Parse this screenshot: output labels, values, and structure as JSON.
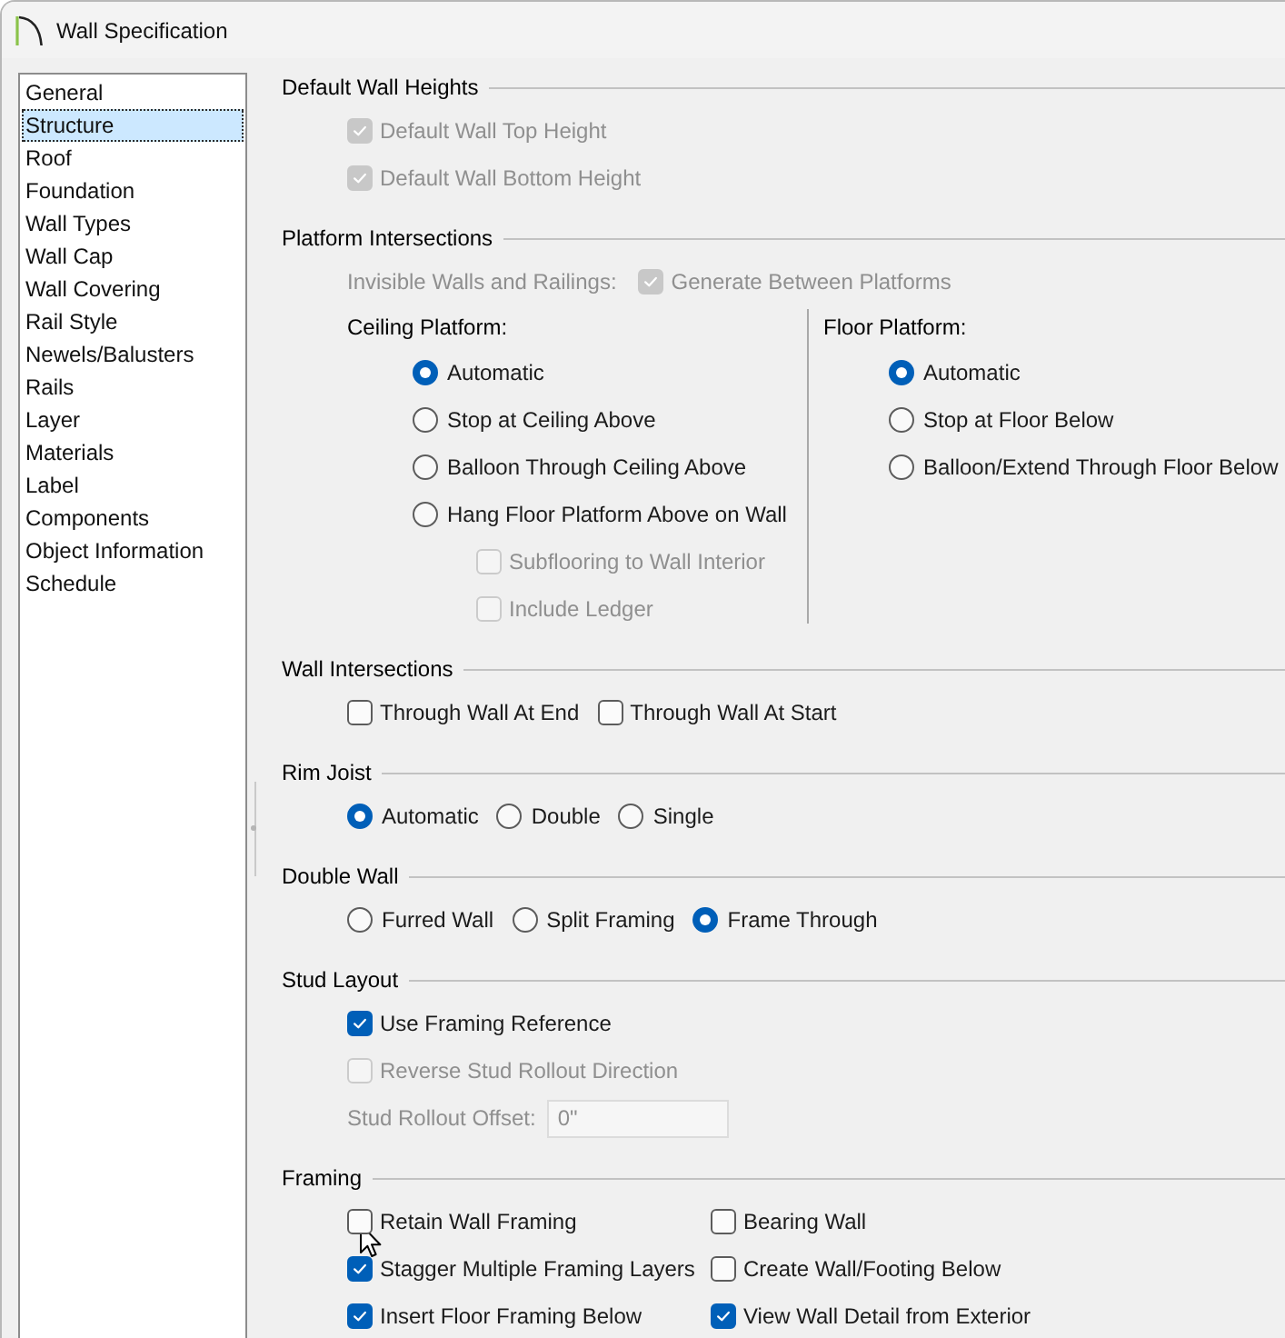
{
  "window": {
    "title": "Wall Specification"
  },
  "sidebar": {
    "items": [
      {
        "label": "General",
        "selected": false
      },
      {
        "label": "Structure",
        "selected": true
      },
      {
        "label": "Roof",
        "selected": false
      },
      {
        "label": "Foundation",
        "selected": false
      },
      {
        "label": "Wall Types",
        "selected": false
      },
      {
        "label": "Wall Cap",
        "selected": false
      },
      {
        "label": "Wall Covering",
        "selected": false
      },
      {
        "label": "Rail Style",
        "selected": false
      },
      {
        "label": "Newels/Balusters",
        "selected": false
      },
      {
        "label": "Rails",
        "selected": false
      },
      {
        "label": "Layer",
        "selected": false
      },
      {
        "label": "Materials",
        "selected": false
      },
      {
        "label": "Label",
        "selected": false
      },
      {
        "label": "Components",
        "selected": false
      },
      {
        "label": "Object Information",
        "selected": false
      },
      {
        "label": "Schedule",
        "selected": false
      }
    ]
  },
  "sections": [
    {
      "title": "Default Wall Heights",
      "rows": [
        {
          "kind": "checkbox",
          "label": "Default Wall Top Height",
          "checked": true,
          "disabled": true
        },
        {
          "kind": "checkbox",
          "label": "Default Wall Bottom Height",
          "checked": true,
          "disabled": true
        }
      ]
    },
    {
      "title": "Platform Intersections",
      "rows": [
        {
          "kind": "labeled",
          "label": "Invisible Walls and Railings:",
          "disabled": true,
          "controls": [
            {
              "kind": "checkbox",
              "label": "Generate Between Platforms",
              "checked": true,
              "disabled": true
            }
          ]
        },
        {
          "kind": "columns",
          "columns": [
            {
              "title": "Ceiling Platform:",
              "options": [
                {
                  "kind": "radio",
                  "label": "Automatic",
                  "selected": true,
                  "disabled": false
                },
                {
                  "kind": "radio",
                  "label": "Stop at Ceiling Above",
                  "selected": false,
                  "disabled": false
                },
                {
                  "kind": "radio",
                  "label": "Balloon Through Ceiling Above",
                  "selected": false,
                  "disabled": false
                },
                {
                  "kind": "radio",
                  "label": "Hang Floor Platform Above on Wall",
                  "selected": false,
                  "disabled": false,
                  "children": [
                    {
                      "kind": "checkbox",
                      "label": "Subflooring to Wall Interior",
                      "checked": false,
                      "disabled": true
                    },
                    {
                      "kind": "checkbox",
                      "label": "Include Ledger",
                      "checked": false,
                      "disabled": true
                    }
                  ]
                }
              ]
            },
            {
              "title": "Floor Platform:",
              "options": [
                {
                  "kind": "radio",
                  "label": "Automatic",
                  "selected": true,
                  "disabled": false
                },
                {
                  "kind": "radio",
                  "label": "Stop at Floor Below",
                  "selected": false,
                  "disabled": false
                },
                {
                  "kind": "radio",
                  "label": "Balloon/Extend Through Floor Below",
                  "selected": false,
                  "disabled": false
                }
              ]
            }
          ]
        }
      ]
    },
    {
      "title": "Wall Intersections",
      "rows": [
        {
          "kind": "inline",
          "controls": [
            {
              "kind": "checkbox",
              "label": "Through Wall At End",
              "checked": false,
              "disabled": false
            },
            {
              "kind": "checkbox",
              "label": "Through Wall At Start",
              "checked": false,
              "disabled": false
            }
          ]
        }
      ]
    },
    {
      "title": "Rim Joist",
      "rows": [
        {
          "kind": "inline",
          "controls": [
            {
              "kind": "radio",
              "label": "Automatic",
              "selected": true,
              "disabled": false
            },
            {
              "kind": "radio",
              "label": "Double",
              "selected": false,
              "disabled": false
            },
            {
              "kind": "radio",
              "label": "Single",
              "selected": false,
              "disabled": false
            }
          ]
        }
      ]
    },
    {
      "title": "Double Wall",
      "rows": [
        {
          "kind": "inline",
          "controls": [
            {
              "kind": "radio",
              "label": "Furred Wall",
              "selected": false,
              "disabled": false
            },
            {
              "kind": "radio",
              "label": "Split Framing",
              "selected": false,
              "disabled": false
            },
            {
              "kind": "radio",
              "label": "Frame Through",
              "selected": true,
              "disabled": false
            }
          ]
        }
      ]
    },
    {
      "title": "Stud Layout",
      "rows": [
        {
          "kind": "checkbox",
          "label": "Use Framing Reference",
          "checked": true,
          "disabled": false
        },
        {
          "kind": "checkbox",
          "label": "Reverse Stud Rollout Direction",
          "checked": false,
          "disabled": true
        },
        {
          "kind": "field",
          "label": "Stud Rollout Offset:",
          "value": "0\"",
          "disabled": true
        }
      ]
    },
    {
      "title": "Framing",
      "rows": [
        {
          "kind": "grid",
          "controls": [
            {
              "kind": "checkbox",
              "label": "Retain Wall Framing",
              "checked": false,
              "disabled": false
            },
            {
              "kind": "checkbox",
              "label": "Bearing Wall",
              "checked": false,
              "disabled": false
            },
            {
              "kind": "checkbox",
              "label": "Stagger Multiple Framing Layers",
              "checked": true,
              "disabled": false
            },
            {
              "kind": "checkbox",
              "label": "Create Wall/Footing Below",
              "checked": false,
              "disabled": false
            },
            {
              "kind": "checkbox",
              "label": "Insert Floor Framing Below",
              "checked": true,
              "disabled": false
            },
            {
              "kind": "checkbox",
              "label": "View Wall Detail from Exterior",
              "checked": true,
              "disabled": false
            }
          ]
        }
      ]
    }
  ]
}
